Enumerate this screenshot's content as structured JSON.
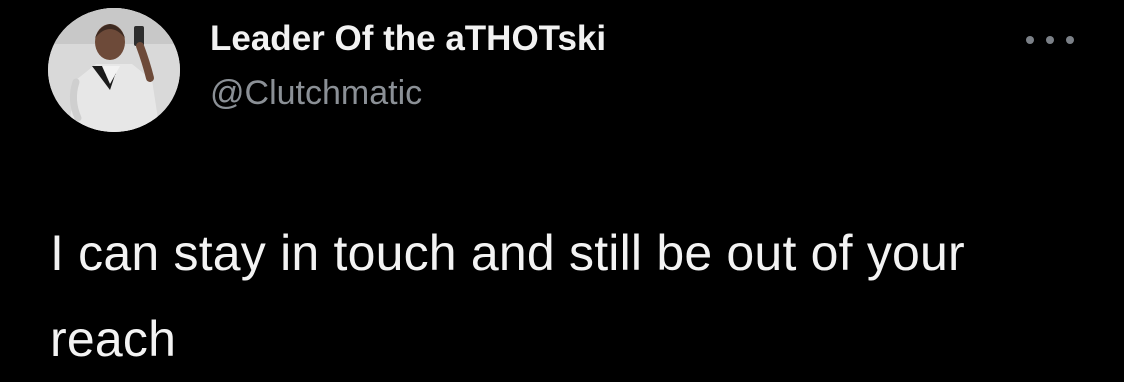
{
  "tweet": {
    "author": {
      "display_name": "Leader Of the aTHOTski",
      "handle": "@Clutchmatic",
      "avatar_icon": "profile-photo-avatar"
    },
    "more_icon": "more-options-icon",
    "text": "I can stay in touch and still be out of your reach"
  },
  "colors": {
    "background": "#000000",
    "display_name": "#f2f2f2",
    "handle": "#8b9096",
    "body_text": "#f3f3f3",
    "more_icon": "#7b8087"
  }
}
